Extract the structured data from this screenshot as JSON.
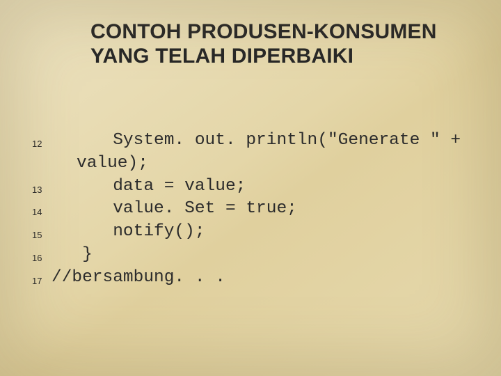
{
  "title": {
    "line1": "CONTOH PRODUSEN-KONSUMEN",
    "line2": "YANG TELAH DIPERBAIKI"
  },
  "code": {
    "lines": [
      {
        "n": "12",
        "text": "      System. out. println(\"Generate \" +",
        "wrap": "value);"
      },
      {
        "n": "13",
        "text": "      data = value;"
      },
      {
        "n": "14",
        "text": "      value. Set = true;"
      },
      {
        "n": "15",
        "text": "      notify();"
      },
      {
        "n": "16",
        "text": "   }"
      },
      {
        "n": "17",
        "text": "//bersambung. . ."
      }
    ]
  }
}
